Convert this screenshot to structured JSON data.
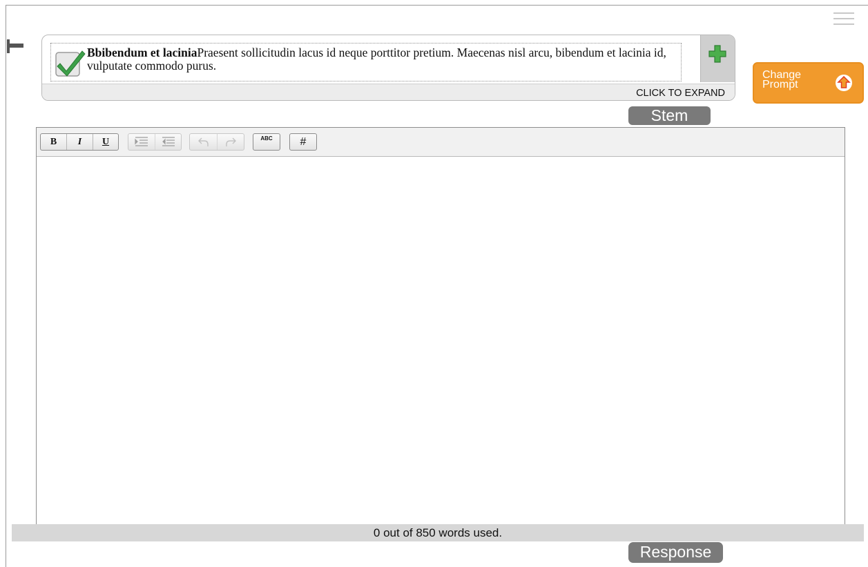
{
  "prompt": {
    "title_bold": "Bbibendum et lacinia",
    "body": "Praesent sollicitudin lacus id neque porttitor pretium. Maecenas nisl arcu, bibendum et lacinia id, vulputate commodo purus.",
    "expand_label": "CLICK TO EXPAND",
    "status_icon": "check-icon",
    "expand_icon": "plus-icon"
  },
  "change_prompt": {
    "label": "Change Prompt",
    "icon": "up-arrow-icon"
  },
  "stem_label": "Stem",
  "toolbar": {
    "bold": "B",
    "italic": "I",
    "underline": "U",
    "spellcheck": "ABC",
    "special_char": "#"
  },
  "word_count": "0 out of 850 words used.",
  "response_label": "Response",
  "colors": {
    "accent_orange": "#f19a2c",
    "tag_gray": "#7a7a7a",
    "check_green": "#3ea04a"
  }
}
